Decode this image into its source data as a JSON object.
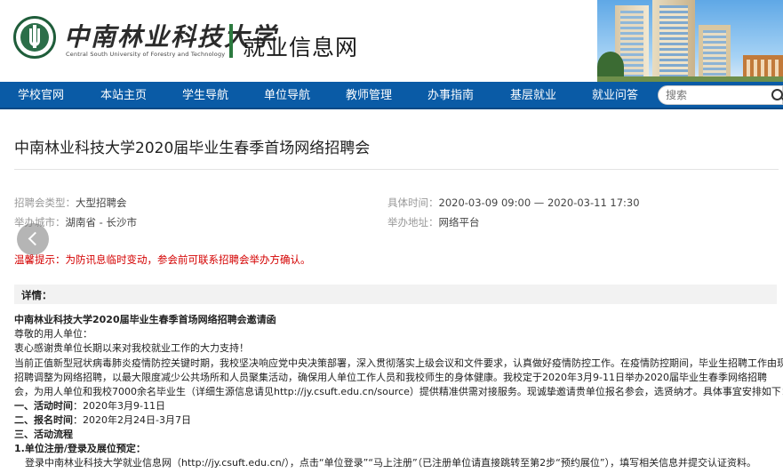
{
  "header": {
    "school_name_cn": "中南林业科技大学",
    "school_name_en": "Central South University of Forestry and Technology",
    "site_name": "就业信息网"
  },
  "nav": {
    "items": [
      "学校官网",
      "本站主页",
      "学生导航",
      "单位导航",
      "教师管理",
      "办事指南",
      "基层就业",
      "就业问答"
    ],
    "search_placeholder": "搜索"
  },
  "article": {
    "title": "中南林业科技大学2020届毕业生春季首场网络招聘会",
    "meta": {
      "type_label": "招聘会类型：",
      "type_value": "大型招聘会",
      "time_label": "具体时间：",
      "time_value": "2020-03-09 09:00 — 2020-03-11 17:30",
      "city_label": "举办城市：",
      "city_value": "湖南省 - 长沙市",
      "address_label": "举办地址：",
      "address_value": "网络平台"
    },
    "tip_label": "温馨提示：",
    "tip_value": "为防讯息临时变动，参会前可联系招聘会举办方确认。",
    "detail_label": "详情：",
    "body": {
      "heading": "中南林业科技大学2020届毕业生春季首场网络招聘会邀请函",
      "greeting": "尊敬的用人单位：",
      "thanks": "衷心感谢贵单位长期以来对我校就业工作的大力支持！",
      "para1_line1": "当前正值新型冠状病毒肺炎疫情防控关键时期，我校坚决响应党中央决策部署，深入贯彻落实上级会议和文件要求，认真做好疫情防控工作。在疫情防控期间，毕业生招聘工作由现场",
      "para1_line2": "招聘调整为网络招聘，以最大限度减少公共场所和人员聚集活动，确保用人单位工作人员和我校师生的身体健康。我校定于2020年3月9-11日举办2020届毕业生春季网络招聘",
      "para1_line3": "会，为用人单位和我校7000余名毕业生（详细生源信息请见http://jy.csuft.edu.cn/source）提供精准供需对接服务。现诚挚邀请贵单位报名参会，选贤纳才。具体事宜安排如下：",
      "s1_label": "一、活动时间",
      "s1_value": "：2020年3月9-11日",
      "s2_label": "二、报名时间",
      "s2_value": "：2020年2月24日-3月7日",
      "s3_label": "三、活动流程",
      "step1_label": "1.单位注册/登录及展位预定：",
      "step1_text": "登录中南林业科技大学就业信息网（http://jy.csuft.edu.cn/），点击“单位登录”“马上注册”（已注册单位请直接跳转至第2步“预约展位”），填写相关信息并提交认证资料。"
    }
  }
}
